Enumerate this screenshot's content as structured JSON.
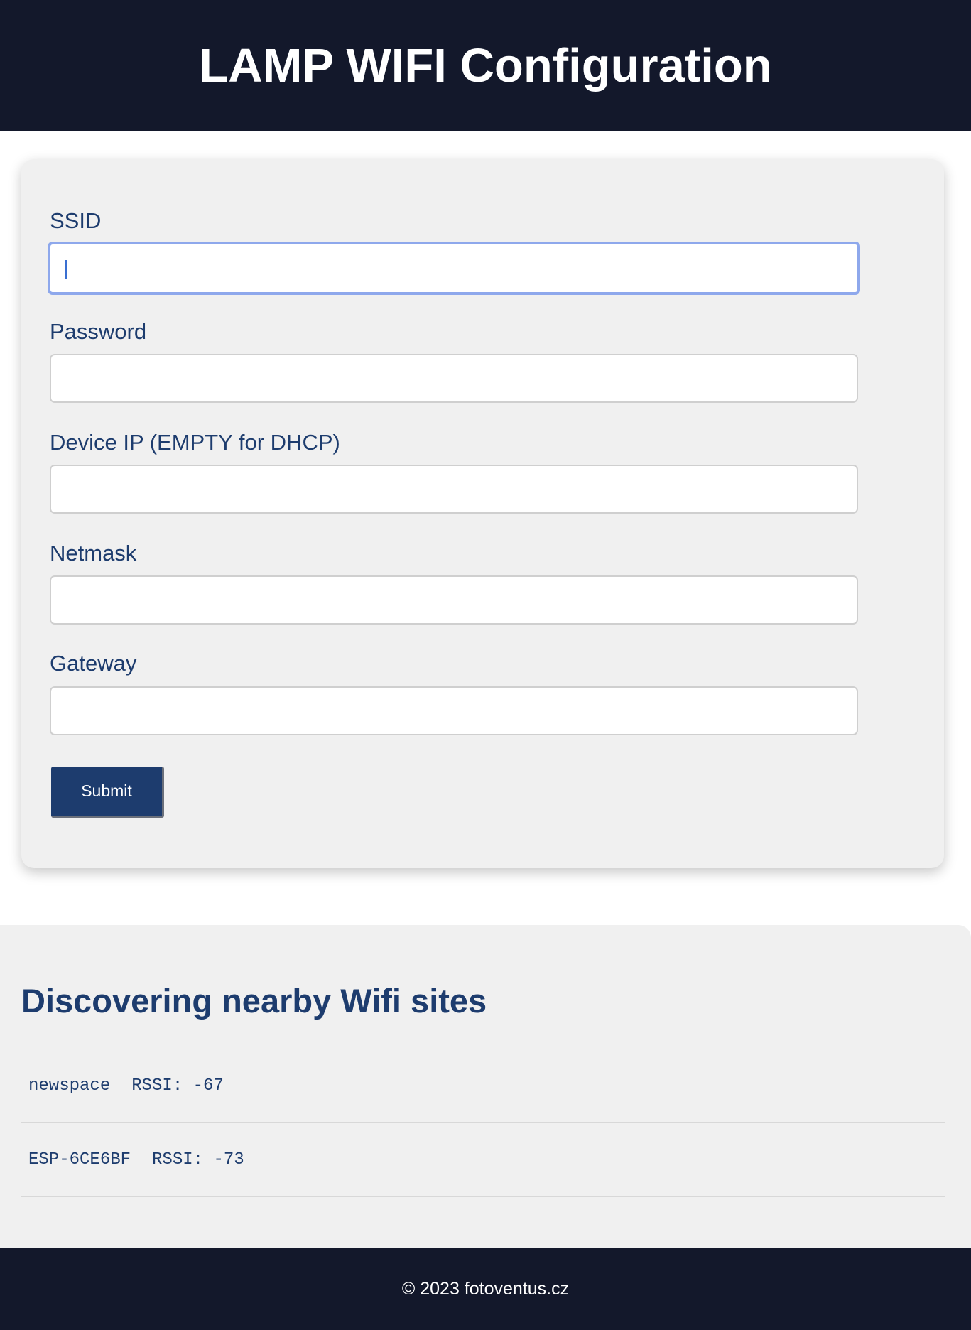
{
  "header": {
    "title": "LAMP WIFI Configuration"
  },
  "form": {
    "fields": [
      {
        "label": "SSID",
        "value": "",
        "focused": true
      },
      {
        "label": "Password",
        "value": ""
      },
      {
        "label": "Device IP (EMPTY for DHCP)",
        "value": ""
      },
      {
        "label": "Netmask",
        "value": ""
      },
      {
        "label": "Gateway",
        "value": ""
      }
    ],
    "submit_label": "Submit"
  },
  "wifi": {
    "title": "Discovering nearby Wifi sites",
    "networks": [
      {
        "ssid": "newspace",
        "rssi": "RSSI: -67"
      },
      {
        "ssid": "ESP-6CE6BF",
        "rssi": "RSSI: -73"
      }
    ]
  },
  "footer": {
    "text": "© 2023 fotoventus.cz"
  },
  "colors": {
    "header_bg": "#13182b",
    "accent": "#1d3c6e",
    "card_bg": "#f0f0f0",
    "focus_border": "#8ea8ec"
  }
}
